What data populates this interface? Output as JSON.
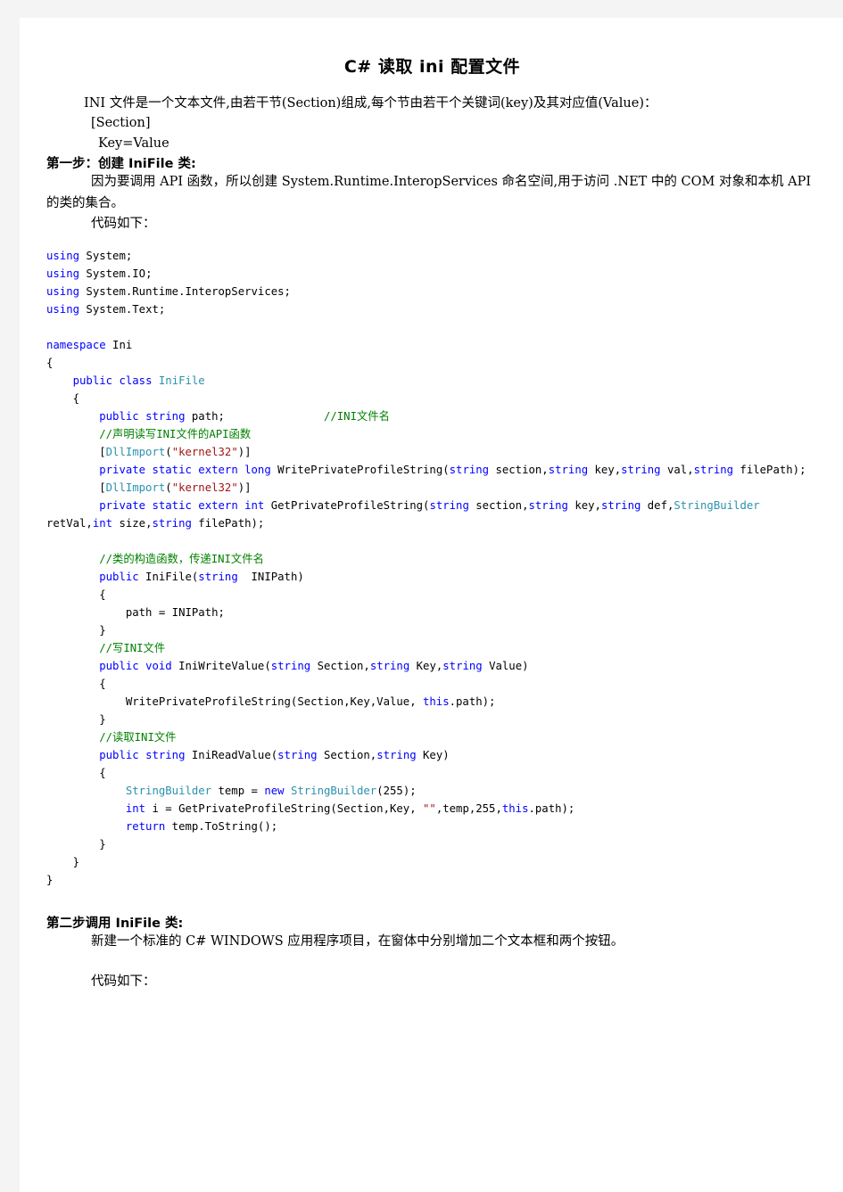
{
  "document": {
    "title": "C#  读取 ini 配置文件",
    "intro": {
      "line1": "INI 文件是一个文本文件,由若干节(Section)组成,每个节由若干个关键词(key)及其对应值(Value)：",
      "line2": "[Section]",
      "line3": "Key=Value"
    },
    "step1": {
      "heading": "第一步：创建 IniFile 类:",
      "paragraph": "因为要调用 API 函数，所以创建 System.Runtime.InteropServices 命名空间,用于访问 .NET 中的 COM 对象和本机 API 的类的集合。",
      "code_label": "代码如下："
    },
    "step2": {
      "heading": "第二步调用 IniFile 类:",
      "paragraph": "新建一个标准的 C# WINDOWS 应用程序项目，在窗体中分别增加二个文本框和两个按钮。",
      "code_label": "代码如下："
    },
    "code": {
      "lines": [
        {
          "indent": 0,
          "tokens": [
            {
              "t": "using",
              "c": "kw"
            },
            {
              "t": " System;",
              "c": ""
            }
          ]
        },
        {
          "indent": 0,
          "tokens": [
            {
              "t": "using",
              "c": "kw"
            },
            {
              "t": " System.IO;",
              "c": ""
            }
          ]
        },
        {
          "indent": 0,
          "tokens": [
            {
              "t": "using",
              "c": "kw"
            },
            {
              "t": " System.Runtime.InteropServices;",
              "c": ""
            }
          ]
        },
        {
          "indent": 0,
          "tokens": [
            {
              "t": "using",
              "c": "kw"
            },
            {
              "t": " System.Text;",
              "c": ""
            }
          ]
        },
        {
          "indent": 0,
          "tokens": []
        },
        {
          "indent": 0,
          "tokens": [
            {
              "t": "namespace",
              "c": "kw"
            },
            {
              "t": " Ini",
              "c": ""
            }
          ]
        },
        {
          "indent": 0,
          "tokens": [
            {
              "t": "{",
              "c": ""
            }
          ]
        },
        {
          "indent": 1,
          "tokens": [
            {
              "t": "public",
              "c": "kw"
            },
            {
              "t": " ",
              "c": ""
            },
            {
              "t": "class",
              "c": "kw"
            },
            {
              "t": " ",
              "c": ""
            },
            {
              "t": "IniFile",
              "c": "typ"
            }
          ]
        },
        {
          "indent": 1,
          "tokens": [
            {
              "t": "{",
              "c": ""
            }
          ]
        },
        {
          "indent": 2,
          "tokens": [
            {
              "t": "public",
              "c": "kw"
            },
            {
              "t": " ",
              "c": ""
            },
            {
              "t": "string",
              "c": "kw"
            },
            {
              "t": " path;",
              "c": ""
            },
            {
              "t": "               ",
              "c": ""
            },
            {
              "t": "//INI文件名",
              "c": "cmt"
            }
          ]
        },
        {
          "indent": 2,
          "tokens": [
            {
              "t": "//声明读写INI文件的API函数",
              "c": "cmt"
            }
          ]
        },
        {
          "indent": 2,
          "tokens": [
            {
              "t": "[",
              "c": ""
            },
            {
              "t": "DllImport",
              "c": "typ"
            },
            {
              "t": "(",
              "c": ""
            },
            {
              "t": "\"kernel32\"",
              "c": "str"
            },
            {
              "t": ")]",
              "c": ""
            }
          ]
        },
        {
          "indent": 2,
          "tokens": [
            {
              "t": "private",
              "c": "kw"
            },
            {
              "t": " ",
              "c": ""
            },
            {
              "t": "static",
              "c": "kw"
            },
            {
              "t": " ",
              "c": ""
            },
            {
              "t": "extern",
              "c": "kw"
            },
            {
              "t": " ",
              "c": ""
            },
            {
              "t": "long",
              "c": "kw"
            },
            {
              "t": " WritePrivateProfileString(",
              "c": ""
            },
            {
              "t": "string",
              "c": "kw"
            },
            {
              "t": " section,",
              "c": ""
            },
            {
              "t": "string",
              "c": "kw"
            },
            {
              "t": " key,",
              "c": ""
            },
            {
              "t": "string",
              "c": "kw"
            },
            {
              "t": " val,",
              "c": ""
            },
            {
              "t": "string",
              "c": "kw"
            },
            {
              "t": " filePath);",
              "c": ""
            }
          ]
        },
        {
          "indent": 2,
          "tokens": [
            {
              "t": "[",
              "c": ""
            },
            {
              "t": "DllImport",
              "c": "typ"
            },
            {
              "t": "(",
              "c": ""
            },
            {
              "t": "\"kernel32\"",
              "c": "str"
            },
            {
              "t": ")]",
              "c": ""
            }
          ]
        },
        {
          "indent": 2,
          "tokens": [
            {
              "t": "private",
              "c": "kw"
            },
            {
              "t": " ",
              "c": ""
            },
            {
              "t": "static",
              "c": "kw"
            },
            {
              "t": " ",
              "c": ""
            },
            {
              "t": "extern",
              "c": "kw"
            },
            {
              "t": " ",
              "c": ""
            },
            {
              "t": "int",
              "c": "kw"
            },
            {
              "t": " GetPrivateProfileString(",
              "c": ""
            },
            {
              "t": "string",
              "c": "kw"
            },
            {
              "t": " section,",
              "c": ""
            },
            {
              "t": "string",
              "c": "kw"
            },
            {
              "t": " key,",
              "c": ""
            },
            {
              "t": "string",
              "c": "kw"
            },
            {
              "t": " def,",
              "c": ""
            },
            {
              "t": "StringBuilder",
              "c": "typ"
            },
            {
              "t": " retVal,",
              "c": ""
            },
            {
              "t": "int",
              "c": "kw"
            },
            {
              "t": " size,",
              "c": ""
            },
            {
              "t": "string",
              "c": "kw"
            },
            {
              "t": " filePath);",
              "c": ""
            }
          ]
        },
        {
          "indent": 0,
          "tokens": []
        },
        {
          "indent": 2,
          "tokens": [
            {
              "t": "//类的构造函数，传递INI文件名",
              "c": "cmt"
            }
          ]
        },
        {
          "indent": 2,
          "tokens": [
            {
              "t": "public",
              "c": "kw"
            },
            {
              "t": " IniFile(",
              "c": ""
            },
            {
              "t": "string",
              "c": "kw"
            },
            {
              "t": "  INIPath)",
              "c": ""
            }
          ]
        },
        {
          "indent": 2,
          "tokens": [
            {
              "t": "{",
              "c": ""
            }
          ]
        },
        {
          "indent": 3,
          "tokens": [
            {
              "t": "path = INIPath;",
              "c": ""
            }
          ]
        },
        {
          "indent": 2,
          "tokens": [
            {
              "t": "}",
              "c": ""
            }
          ]
        },
        {
          "indent": 2,
          "tokens": [
            {
              "t": "//写INI文件",
              "c": "cmt"
            }
          ]
        },
        {
          "indent": 2,
          "tokens": [
            {
              "t": "public",
              "c": "kw"
            },
            {
              "t": " ",
              "c": ""
            },
            {
              "t": "void",
              "c": "kw"
            },
            {
              "t": " IniWriteValue(",
              "c": ""
            },
            {
              "t": "string",
              "c": "kw"
            },
            {
              "t": " Section,",
              "c": ""
            },
            {
              "t": "string",
              "c": "kw"
            },
            {
              "t": " Key,",
              "c": ""
            },
            {
              "t": "string",
              "c": "kw"
            },
            {
              "t": " Value)",
              "c": ""
            }
          ]
        },
        {
          "indent": 2,
          "tokens": [
            {
              "t": "{",
              "c": ""
            }
          ]
        },
        {
          "indent": 3,
          "tokens": [
            {
              "t": "WritePrivateProfileString(Section,Key,Value, ",
              "c": ""
            },
            {
              "t": "this",
              "c": "kw"
            },
            {
              "t": ".path);",
              "c": ""
            }
          ]
        },
        {
          "indent": 2,
          "tokens": [
            {
              "t": "}",
              "c": ""
            }
          ]
        },
        {
          "indent": 2,
          "tokens": [
            {
              "t": "//读取INI文件",
              "c": "cmt"
            }
          ]
        },
        {
          "indent": 2,
          "tokens": [
            {
              "t": "public",
              "c": "kw"
            },
            {
              "t": " ",
              "c": ""
            },
            {
              "t": "string",
              "c": "kw"
            },
            {
              "t": " IniReadValue(",
              "c": ""
            },
            {
              "t": "string",
              "c": "kw"
            },
            {
              "t": " Section,",
              "c": ""
            },
            {
              "t": "string",
              "c": "kw"
            },
            {
              "t": " Key)",
              "c": ""
            }
          ]
        },
        {
          "indent": 2,
          "tokens": [
            {
              "t": "{",
              "c": ""
            }
          ]
        },
        {
          "indent": 3,
          "tokens": [
            {
              "t": "StringBuilder",
              "c": "typ"
            },
            {
              "t": " temp = ",
              "c": ""
            },
            {
              "t": "new",
              "c": "kw"
            },
            {
              "t": " ",
              "c": ""
            },
            {
              "t": "StringBuilder",
              "c": "typ"
            },
            {
              "t": "(255);",
              "c": ""
            }
          ]
        },
        {
          "indent": 3,
          "tokens": [
            {
              "t": "int",
              "c": "kw"
            },
            {
              "t": " i = GetPrivateProfileString(Section,Key, ",
              "c": ""
            },
            {
              "t": "\"\"",
              "c": "str"
            },
            {
              "t": ",temp,255,",
              "c": ""
            },
            {
              "t": "this",
              "c": "kw"
            },
            {
              "t": ".path);",
              "c": ""
            }
          ]
        },
        {
          "indent": 3,
          "tokens": [
            {
              "t": "return",
              "c": "kw"
            },
            {
              "t": " temp.ToString();",
              "c": ""
            }
          ]
        },
        {
          "indent": 2,
          "tokens": [
            {
              "t": "}",
              "c": ""
            }
          ]
        },
        {
          "indent": 1,
          "tokens": [
            {
              "t": "}",
              "c": ""
            }
          ]
        },
        {
          "indent": 0,
          "tokens": [
            {
              "t": "}",
              "c": ""
            }
          ]
        }
      ]
    },
    "colors": {
      "page_background": "#ffffff",
      "canvas_background": "#f4f4f4",
      "keyword": "#0000ff",
      "type": "#2b91af",
      "string": "#a31515",
      "comment": "#008000",
      "text": "#000000"
    }
  }
}
